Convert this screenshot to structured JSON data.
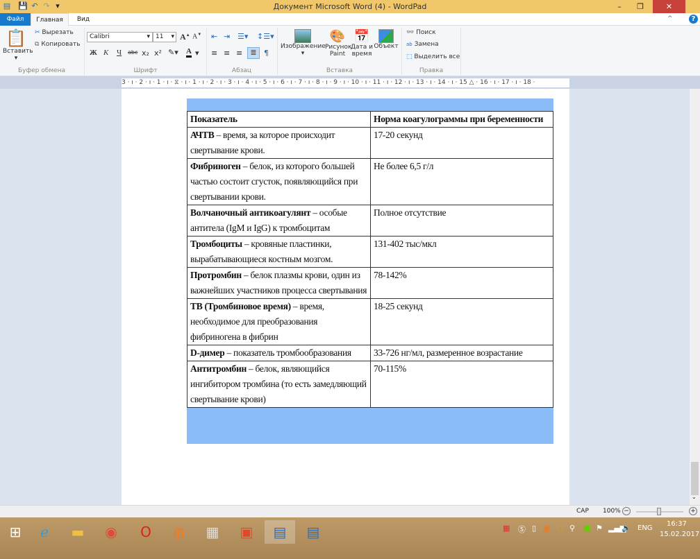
{
  "window": {
    "title": "Документ Microsoft Word (4) - WordPad",
    "minimize": "–",
    "restore": "❐",
    "close": "✕"
  },
  "tabs": [
    {
      "label": "Файл"
    },
    {
      "label": "Главная"
    },
    {
      "label": "Вид"
    }
  ],
  "ribbon": {
    "clipboard": {
      "group": "Буфер обмена",
      "paste": "Вставить",
      "cut": "Вырезать",
      "copy": "Копировать"
    },
    "font": {
      "group": "Шрифт",
      "family": "Calibri",
      "size": "11",
      "bold": "Ж",
      "italic": "К",
      "underline": "Ч",
      "strike": "abc",
      "sub": "x₂",
      "sup": "x²"
    },
    "paragraph": {
      "group": "Абзац"
    },
    "insert": {
      "group": "Вставка",
      "image": "Изображение",
      "paint": "Рисунок Paint",
      "datetime": "Дата и время",
      "object": "Объект"
    },
    "edit": {
      "group": "Правка",
      "find": "Поиск",
      "replace": "Замена",
      "select_all": "Выделить все"
    }
  },
  "ruler": "3 · ı · 2 · ı · 1 · ı · ⧖ · ı · 1 · ı · 2 · ı · 3 · ı · 4 · ı · 5 · ı · 6 · ı · 7 · ı · 8 · ı · 9 · ı · 10 · ı · 11 · ı · 12 · ı · 13 · ı · 14 · ı · 15 △ · 16 · ı · 17 · ı · 18 ·",
  "table": {
    "header": [
      "Показатель",
      "Норма коагулограммы при беременности"
    ],
    "rows": [
      {
        "term": "АЧТВ",
        "desc": " – время, за которое происходит свертывание крови.",
        "norm": "17-20 секунд"
      },
      {
        "term": "Фибриноген",
        "desc": " – белок, из которого большей частью состоит сгусток, появляющийся при свертывании крови.",
        "norm": "Не более 6,5 г/л"
      },
      {
        "term": "Волчаночный антикоагулянт",
        "desc": " – особые антитела (IgM и IgG) к тромбоцитам",
        "norm": "Полное отсутствие"
      },
      {
        "term": "Тромбоциты",
        "desc": " – кровяные пластинки, вырабатывающиеся костным мозгом.",
        "norm": "131-402 тыс/мкл"
      },
      {
        "term": "Протромбин",
        "desc": " – белок плазмы крови, один из важнейших участников процесса свертывания",
        "norm": "78-142%"
      },
      {
        "term": "ТВ (Тромбиновое время)",
        "desc": " – время, необходимое для преобразования фибриногена в фибрин",
        "norm": "18-25 секунд"
      },
      {
        "term": "D-димер",
        "desc": " – показатель тромбообразования",
        "norm": "33-726 нг/мл, размеренное возрастание"
      },
      {
        "term": "Антитромбин",
        "desc": " – белок, являющийся ингибитором тромбина (то есть замедляющий свертывание крови)",
        "norm": "70-115%"
      }
    ]
  },
  "status": {
    "cap": "CAP",
    "zoom": "100%",
    "zoom_level_percent": 100
  },
  "taskbar": {
    "lang": "ENG",
    "time": "16:37",
    "date": "15.02.2017"
  },
  "colors": {
    "titlebar": "#f1c76c",
    "file_tab": "#1979ca",
    "close": "#c7413a",
    "image_bg": "#8abcf8",
    "taskbar": "#b08c5c"
  }
}
